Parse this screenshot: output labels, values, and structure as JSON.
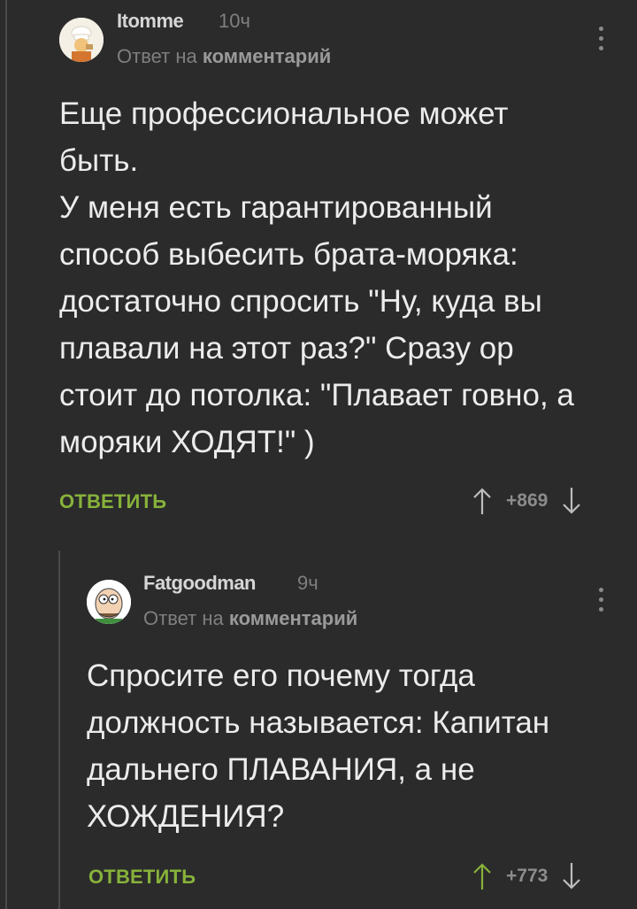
{
  "comments": [
    {
      "username": "Itomme",
      "time": "10ч",
      "reply_prefix": "Ответ на",
      "reply_target": "комментарий",
      "body": "Еще профессиональное может\nбыть.\nУ меня есть гарантированный\nспособ выбесить брата-моряка:\nдостаточно спросить \"Ну, куда вы\nплавали на этот раз?\" Сразу ор\nстоит до потолка: \"Плавает говно, а\nморяки ХОДЯТ!\" )",
      "reply_label": "ОТВЕТИТЬ",
      "score": "+869",
      "avatar_icon": "chef-avatar-icon"
    },
    {
      "username": "Fatgoodman",
      "time": "9ч",
      "reply_prefix": "Ответ на",
      "reply_target": "комментарий",
      "body": "Спросите его почему тогда\nдолжность называется: Капитан\nдальнего ПЛАВАНИЯ, а не\nХОЖДЕНИЯ?",
      "reply_label": "ОТВЕТИТЬ",
      "score": "+773",
      "avatar_icon": "peter-griffin-avatar-icon"
    }
  ],
  "colors": {
    "background": "#2b2b2b",
    "accent_green": "#87b23a",
    "upvote_green": "#87b23a",
    "muted": "#7f7f7f"
  }
}
